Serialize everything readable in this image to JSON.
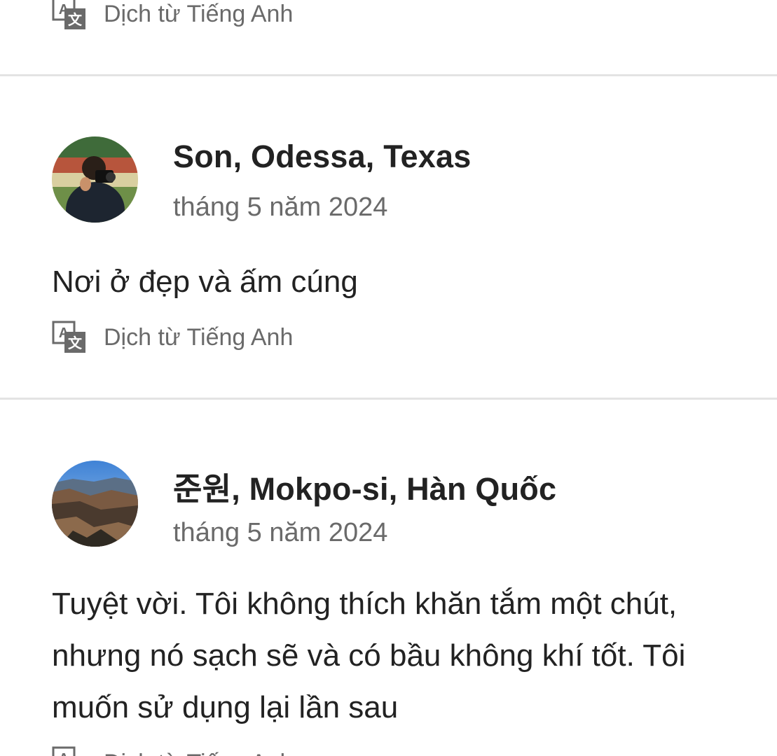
{
  "translate_label": "Dịch từ Tiếng Anh",
  "colors": {
    "text_primary": "#222222",
    "text_secondary": "#6a6a6a",
    "divider": "#e3e3e3"
  },
  "reviews": [
    {
      "reviewer": "Son, Odessa, Texas",
      "date": "tháng 5 năm 2024",
      "text": "Nơi ở đẹp và ấm cúng",
      "translate_label": "Dịch từ Tiếng Anh"
    },
    {
      "reviewer": "준원, Mokpo-si, Hàn Quốc",
      "date": "tháng 5 năm 2024",
      "text": "Tuyệt vời. Tôi không thích khăn tắm một chút, nhưng nó sạch sẽ và có bầu không khí tốt. Tôi muốn sử dụng lại lần sau",
      "translate_label": "Dịch từ Tiếng Anh"
    }
  ]
}
